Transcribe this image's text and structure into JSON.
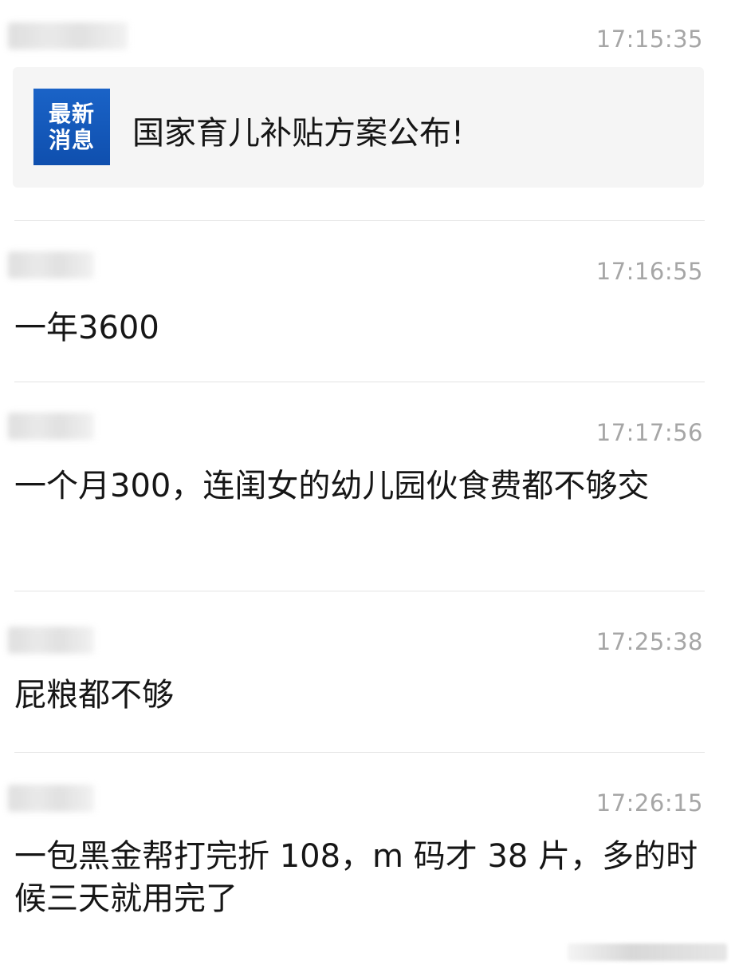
{
  "messages": [
    {
      "time": "17:15:35",
      "share": {
        "badge_line1": "最新",
        "badge_line2": "消息",
        "title": "国家育儿补贴方案公布!"
      }
    },
    {
      "time": "17:16:55",
      "text": "一年3600"
    },
    {
      "time": "17:17:56",
      "text": "一个月300，连闺女的幼儿园伙食费都不够交"
    },
    {
      "time": "17:25:38",
      "text": "屁粮都不够"
    },
    {
      "time": "17:26:15",
      "text": "一包黑金帮打完折 108，m 码才 38 片，多的时候三天就用完了"
    }
  ],
  "colors": {
    "badge_blue": "#1a63c7",
    "timestamp_gray": "#a6a6a6",
    "card_background": "#f5f5f5",
    "divider": "#e3e3e3"
  }
}
